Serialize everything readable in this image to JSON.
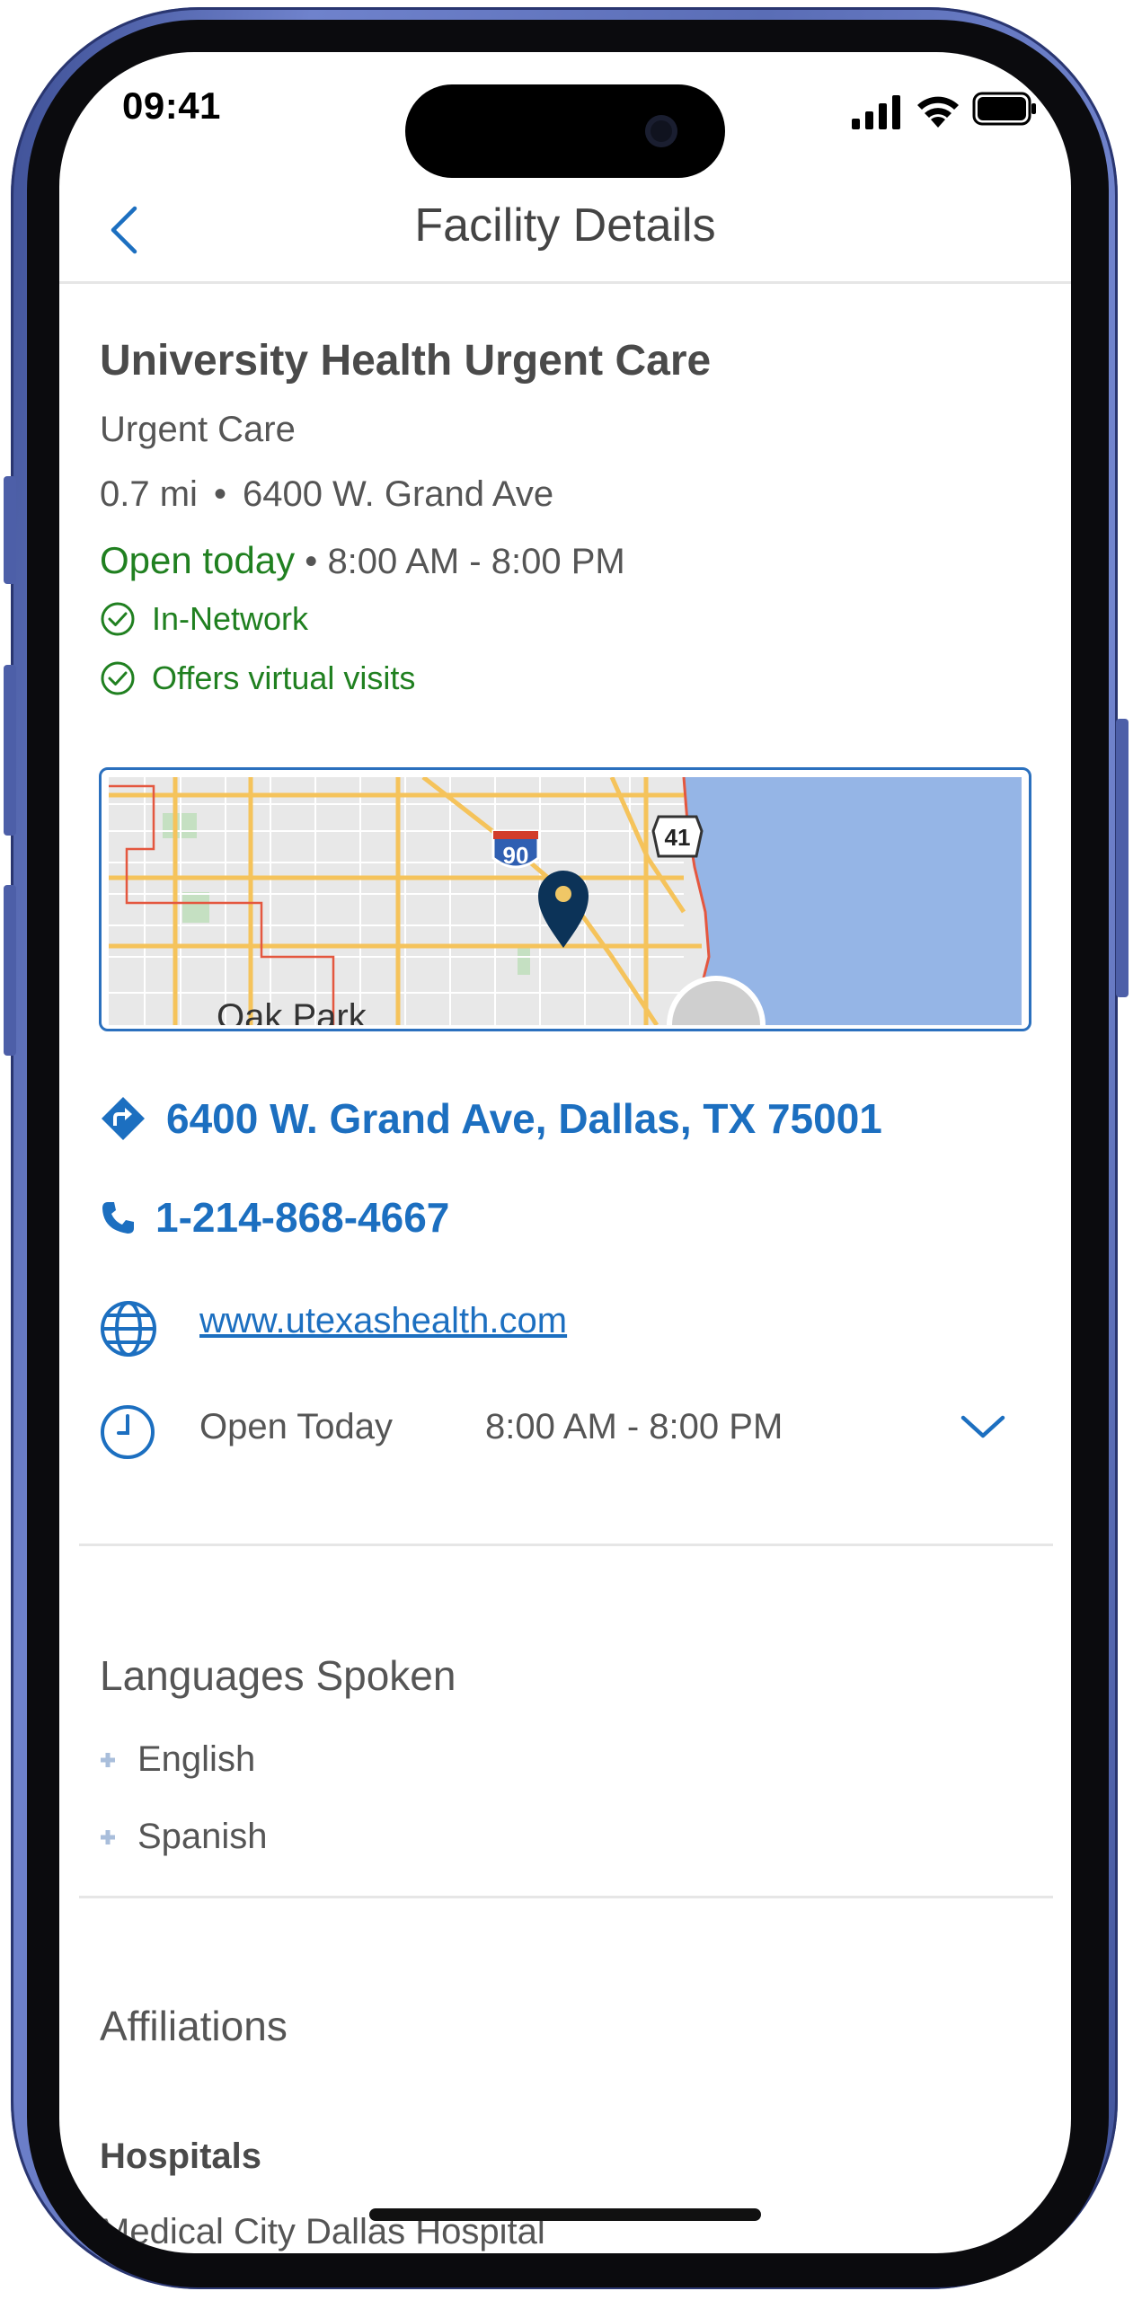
{
  "status_bar": {
    "time": "09:41"
  },
  "header": {
    "title": "Facility Details"
  },
  "facility": {
    "name": "University Health Urgent Care",
    "type": "Urgent Care",
    "distance": "0.7 mi",
    "separator": "•",
    "street": "6400 W. Grand Ave",
    "open_status": "Open today",
    "hours": "8:00 AM - 8:00 PM",
    "badges": [
      "In-Network",
      "Offers virtual visits"
    ]
  },
  "map": {
    "labels": {
      "highway_90": "90",
      "highway_41": "41",
      "place": "Oak Park"
    },
    "colors": {
      "water": "#95b5e6",
      "land": "#e8e8e8",
      "road": "#f5c35b",
      "pin": "#0c3358",
      "boundary": "#e4573f"
    }
  },
  "contact": {
    "address": "6400 W. Grand Ave, Dallas, TX 75001",
    "phone": "1-214-868-4667",
    "website": "www.utexashealth.com",
    "open_label": "Open Today",
    "open_hours": "8:00 AM - 8:00 PM"
  },
  "languages": {
    "title": "Languages Spoken",
    "items": [
      "English",
      "Spanish"
    ]
  },
  "affiliations": {
    "title": "Affiliations",
    "hospitals_label": "Hospitals",
    "hospitals": [
      "Medical City Dallas Hospital"
    ]
  },
  "colors": {
    "accent": "#1c6fc0",
    "positive": "#208020",
    "frame": "#5a6db6"
  }
}
